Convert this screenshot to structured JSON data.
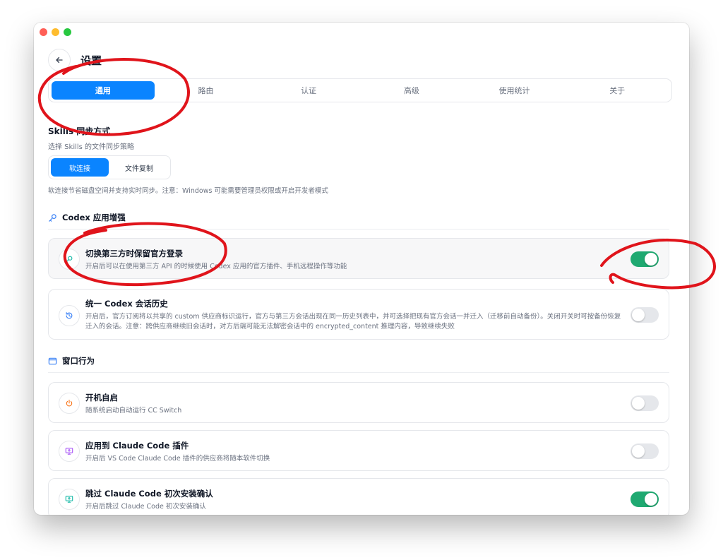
{
  "header": {
    "title": "设置"
  },
  "tabs": [
    {
      "label": "通用",
      "active": true
    },
    {
      "label": "路由",
      "active": false
    },
    {
      "label": "认证",
      "active": false
    },
    {
      "label": "高级",
      "active": false
    },
    {
      "label": "使用统计",
      "active": false
    },
    {
      "label": "关于",
      "active": false
    }
  ],
  "skills": {
    "title": "Skills 同步方式",
    "desc": "选择 Skills 的文件同步策略",
    "options": [
      {
        "label": "软连接",
        "active": true
      },
      {
        "label": "文件复制",
        "active": false
      }
    ],
    "note": "软连接节省磁盘空间并支持实时同步。注意：Windows 可能需要管理员权限或开启开发者模式"
  },
  "codex": {
    "group_title": "Codex 应用增强",
    "item1": {
      "title": "切换第三方时保留官方登录",
      "desc": "开启后可以在使用第三方 API 的时候使用 Codex 应用的官方插件、手机远程操作等功能",
      "enabled": true
    },
    "item2": {
      "title": "统一 Codex 会话历史",
      "desc": "开启后，官方订阅将以共享的 custom 供应商标识运行，官方与第三方会话出现在同一历史列表中，并可选择把现有官方会话一并迁入（迁移前自动备份）。关闭开关时可按备份恢复迁入的会话。注意：跨供应商继续旧会话时，对方后端可能无法解密会话中的 encrypted_content 推理内容，导致继续失败",
      "enabled": false
    }
  },
  "window": {
    "group_title": "窗口行为",
    "item1": {
      "title": "开机自启",
      "desc": "随系统启动自动运行 CC Switch",
      "enabled": false
    },
    "item2": {
      "title": "应用到 Claude Code 插件",
      "desc": "开启后 VS Code Claude Code 插件的供应商将随本软件切换",
      "enabled": false
    },
    "item3": {
      "title": "跳过 Claude Code 初次安装确认",
      "desc": "开启后跳过 Claude Code 初次安装确认",
      "enabled": true
    }
  },
  "colors": {
    "accent": "#0a84ff",
    "toggle_on": "#1fa971",
    "annotation": "#e0141b"
  },
  "icons": [
    "back-arrow-icon",
    "key-icon",
    "history-icon",
    "window-icon",
    "power-icon",
    "monitor-icon"
  ]
}
